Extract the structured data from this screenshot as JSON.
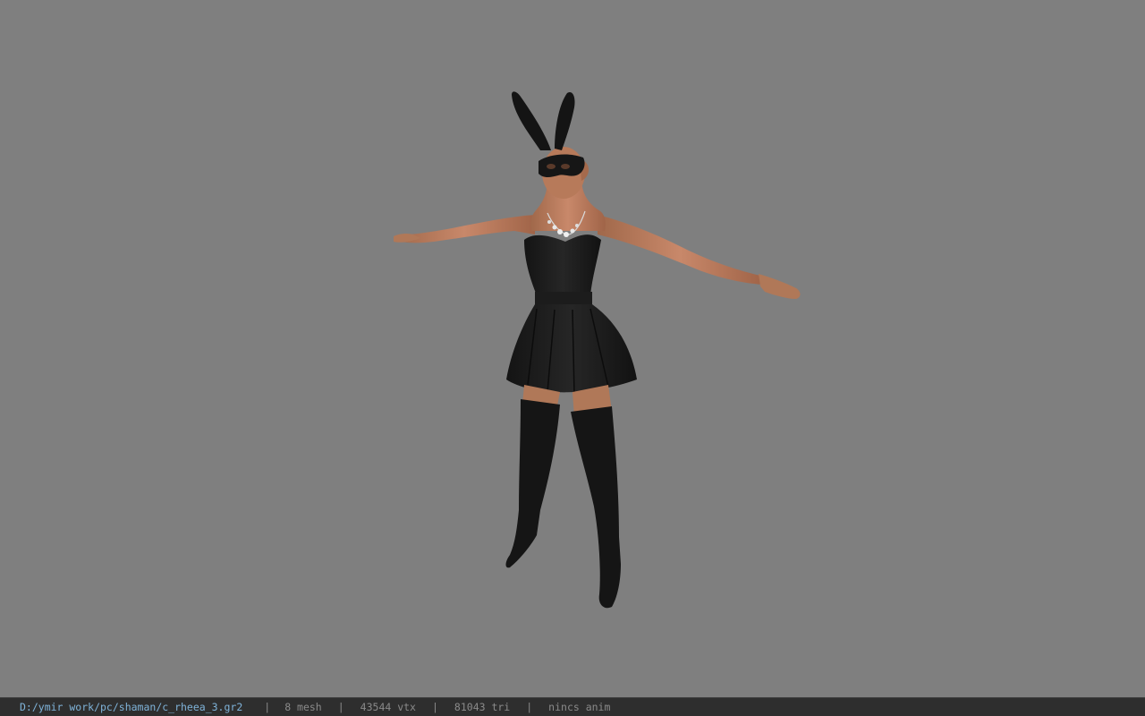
{
  "viewport": {
    "background_color": "#7f7f7f",
    "model_description_icon": "character-model"
  },
  "status_bar": {
    "file_path": "D:/ymir work/pc/shaman/c_rheea_3.gr2",
    "separator": "|",
    "mesh_count": "8 mesh",
    "vertex_count": "43544 vtx",
    "triangle_count": "81043 tri",
    "anim_status": "nincs anim",
    "path_color": "#7fb3d9",
    "text_color": "#8a8a8a",
    "background_color": "#2e2e2e"
  }
}
